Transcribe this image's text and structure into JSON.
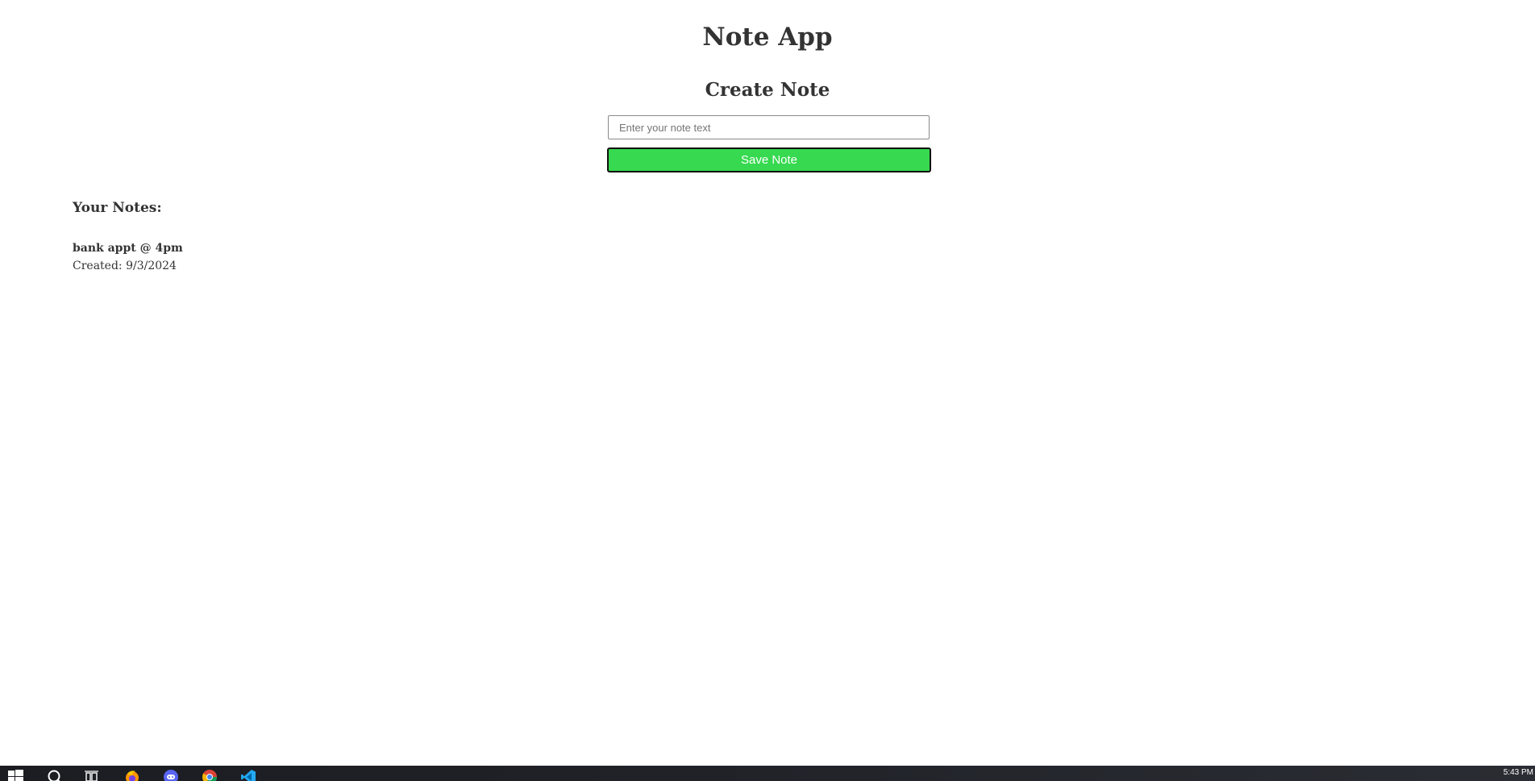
{
  "app": {
    "title": "Note App"
  },
  "create": {
    "heading": "Create Note",
    "input_placeholder": "Enter your note text",
    "input_value": "",
    "save_label": "Save Note"
  },
  "notes": {
    "heading": "Your Notes:",
    "items": [
      {
        "text": "bank appt @ 4pm",
        "created": "Created: 9/3/2024"
      }
    ]
  },
  "taskbar": {
    "icons": [
      "windows-start-icon",
      "search-icon",
      "task-view-icon",
      "firefox-icon",
      "discord-icon",
      "chrome-icon",
      "vscode-icon"
    ],
    "clock": "5:43 PM",
    "accent_colors": {
      "button": "#36d94f",
      "taskbar": "#1b1d22"
    }
  }
}
